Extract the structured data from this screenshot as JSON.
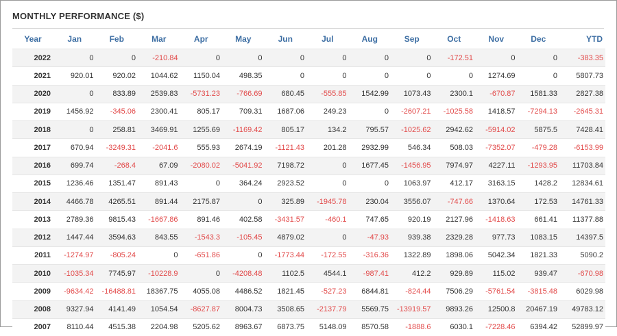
{
  "title": "MONTHLY PERFORMANCE ($)",
  "columns": [
    "Year",
    "Jan",
    "Feb",
    "Mar",
    "Apr",
    "May",
    "Jun",
    "Jul",
    "Aug",
    "Sep",
    "Oct",
    "Nov",
    "Dec",
    "YTD"
  ],
  "rows": [
    [
      "2022",
      "0",
      "0",
      "-210.84",
      "0",
      "0",
      "0",
      "0",
      "0",
      "0",
      "-172.51",
      "0",
      "0",
      "-383.35"
    ],
    [
      "2021",
      "920.01",
      "920.02",
      "1044.62",
      "1150.04",
      "498.35",
      "0",
      "0",
      "0",
      "0",
      "0",
      "1274.69",
      "0",
      "5807.73"
    ],
    [
      "2020",
      "0",
      "833.89",
      "2539.83",
      "-5731.23",
      "-766.69",
      "680.45",
      "-555.85",
      "1542.99",
      "1073.43",
      "2300.1",
      "-670.87",
      "1581.33",
      "2827.38"
    ],
    [
      "2019",
      "1456.92",
      "-345.06",
      "2300.41",
      "805.17",
      "709.31",
      "1687.06",
      "249.23",
      "0",
      "-2607.21",
      "-1025.58",
      "1418.57",
      "-7294.13",
      "-2645.31"
    ],
    [
      "2018",
      "0",
      "258.81",
      "3469.91",
      "1255.69",
      "-1169.42",
      "805.17",
      "134.2",
      "795.57",
      "-1025.62",
      "2942.62",
      "-5914.02",
      "5875.5",
      "7428.41"
    ],
    [
      "2017",
      "670.94",
      "-3249.31",
      "-2041.6",
      "555.93",
      "2674.19",
      "-1121.43",
      "201.28",
      "2932.99",
      "546.34",
      "508.03",
      "-7352.07",
      "-479.28",
      "-6153.99"
    ],
    [
      "2016",
      "699.74",
      "-268.4",
      "67.09",
      "-2080.02",
      "-5041.92",
      "7198.72",
      "0",
      "1677.45",
      "-1456.95",
      "7974.97",
      "4227.11",
      "-1293.95",
      "11703.84"
    ],
    [
      "2015",
      "1236.46",
      "1351.47",
      "891.43",
      "0",
      "364.24",
      "2923.52",
      "0",
      "0",
      "1063.97",
      "412.17",
      "3163.15",
      "1428.2",
      "12834.61"
    ],
    [
      "2014",
      "4466.78",
      "4265.51",
      "891.44",
      "2175.87",
      "0",
      "325.89",
      "-1945.78",
      "230.04",
      "3556.07",
      "-747.66",
      "1370.64",
      "172.53",
      "14761.33"
    ],
    [
      "2013",
      "2789.36",
      "9815.43",
      "-1667.86",
      "891.46",
      "402.58",
      "-3431.57",
      "-460.1",
      "747.65",
      "920.19",
      "2127.96",
      "-1418.63",
      "661.41",
      "11377.88"
    ],
    [
      "2012",
      "1447.44",
      "3594.63",
      "843.55",
      "-1543.3",
      "-105.45",
      "4879.02",
      "0",
      "-47.93",
      "939.38",
      "2329.28",
      "977.73",
      "1083.15",
      "14397.5"
    ],
    [
      "2011",
      "-1274.97",
      "-805.24",
      "0",
      "-651.86",
      "0",
      "-1773.44",
      "-172.55",
      "-316.36",
      "1322.89",
      "1898.06",
      "5042.34",
      "1821.33",
      "5090.2"
    ],
    [
      "2010",
      "-1035.34",
      "7745.97",
      "-10228.9",
      "0",
      "-4208.48",
      "1102.5",
      "4544.1",
      "-987.41",
      "412.2",
      "929.89",
      "115.02",
      "939.47",
      "-670.98"
    ],
    [
      "2009",
      "-9634.42",
      "-16488.81",
      "18367.75",
      "4055.08",
      "4486.52",
      "1821.45",
      "-527.23",
      "6844.81",
      "-824.44",
      "7506.29",
      "-5761.54",
      "-3815.48",
      "6029.98"
    ],
    [
      "2008",
      "9327.94",
      "4141.49",
      "1054.54",
      "-8627.87",
      "8004.73",
      "3508.65",
      "-2137.79",
      "5569.75",
      "-13919.57",
      "9893.26",
      "12500.8",
      "20467.19",
      "49783.12"
    ],
    [
      "2007",
      "8110.44",
      "4515.38",
      "2204.98",
      "5205.62",
      "8963.67",
      "6873.75",
      "5148.09",
      "8570.58",
      "-1888.6",
      "6030.1",
      "-7228.46",
      "6394.42",
      "52899.97"
    ]
  ],
  "colors": {
    "header": "#3d6ea3",
    "negative": "#e24a4a",
    "row_alt": "#f3f3f3"
  }
}
